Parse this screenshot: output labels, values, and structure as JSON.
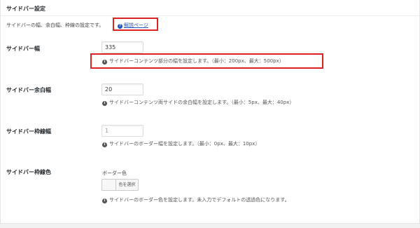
{
  "section": {
    "title": "サイドバー設定",
    "description": "サイドバーの幅、余白幅、枠線の設定です。",
    "help_link_label": "解説ページ"
  },
  "rows": {
    "width": {
      "label": "サイドバー幅",
      "value": "335",
      "hint": "サイドバーコンテンツ部分の幅を設定します。（最小：200px、最大：500px）"
    },
    "padding": {
      "label": "サイドバー余白幅",
      "value": "20",
      "hint": "サイドバーコンテンツ両サイドの余白幅を設定します。（最小：5px、最大：40px）"
    },
    "border_width": {
      "label": "サイドバー枠線幅",
      "value": "1",
      "hint": "サイドバーのボーダー幅を設定します。（最小：0px、最大：10px）"
    },
    "border_color": {
      "label": "サイドバー枠線色",
      "sub_label": "ボーダー色",
      "button_label": "色を選択",
      "hint": "サイドバーのボーダー色を設定します。未入力でデフォルトの透過色になります。"
    }
  },
  "icons": {
    "info": "info-circle-icon",
    "help": "question-circle-icon"
  },
  "colors": {
    "highlight": "#dd2222",
    "link": "#2255bb"
  }
}
